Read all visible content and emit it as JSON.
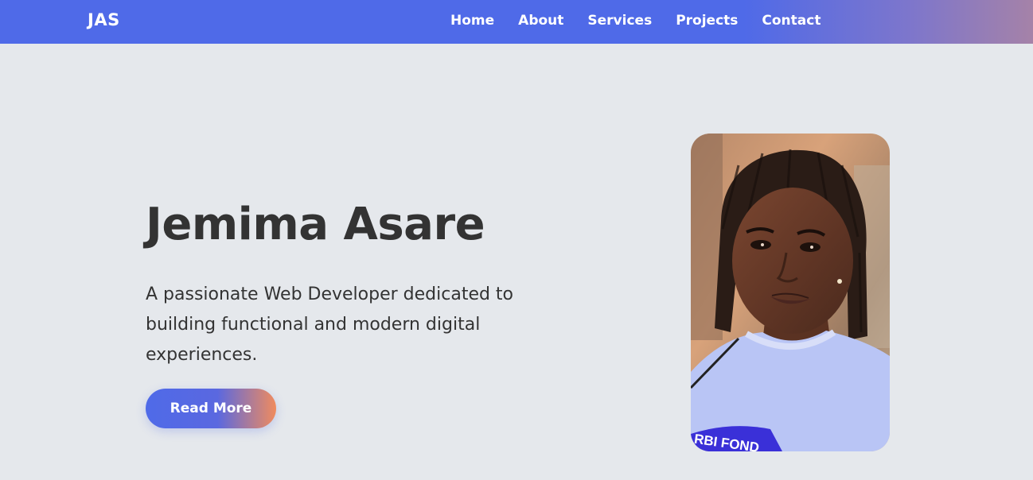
{
  "brand": {
    "logo": "JAS"
  },
  "nav": {
    "items": [
      {
        "label": "Home"
      },
      {
        "label": "About"
      },
      {
        "label": "Services"
      },
      {
        "label": "Projects"
      },
      {
        "label": "Contact"
      }
    ]
  },
  "hero": {
    "name": "Jemima Asare",
    "description": "A passionate Web Developer dedicated to building functional and modern digital experiences.",
    "cta_label": "Read More",
    "photo_shirt_text": "RBI FOND"
  },
  "colors": {
    "nav_start": "#4f6ae8",
    "nav_end": "#a582a8",
    "page_bg": "#e5e8ec",
    "text": "#333333",
    "button_end": "#f08b5e"
  }
}
